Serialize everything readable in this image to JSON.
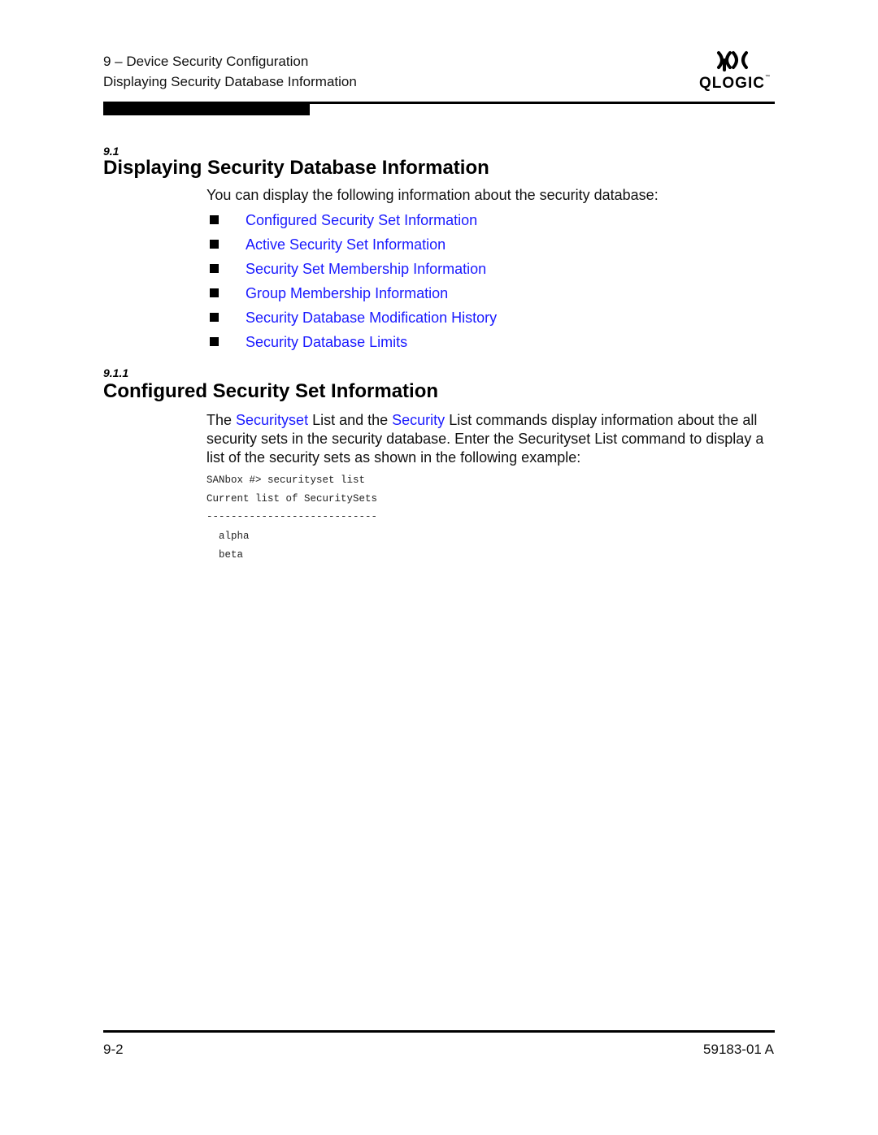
{
  "header": {
    "chapter": "9 – Device Security Configuration",
    "section": "Displaying Security Database Information",
    "logo": {
      "icon": "qlogic-logo-icon",
      "text": "QLOGIC",
      "trademark": "™"
    }
  },
  "section_9_1": {
    "number": "9.1",
    "title": "Displaying Security Database Information",
    "intro": "You can display the following information about the security database:",
    "links": [
      {
        "label": "Configured Security Set Information"
      },
      {
        "label": "Active Security Set Information"
      },
      {
        "label": "Security Set Membership Information"
      },
      {
        "label": "Group Membership Information"
      },
      {
        "label": "Security Database Modification History"
      },
      {
        "label": "Security Database Limits"
      }
    ],
    "bullet_icon": "square-bullet-icon"
  },
  "section_9_1_1": {
    "number": "9.1.1",
    "title": "Configured Security Set Information",
    "paragraph": {
      "part1": "The ",
      "link1": "Securityset",
      "part2": " List and the ",
      "link2": "Security",
      "part3": " List commands display information about the all security sets in the security database. Enter the Securityset List command to display a list of the security sets as shown in the following example:"
    },
    "code": [
      "SANbox #> securityset list",
      "Current list of SecuritySets",
      "----------------------------",
      "  alpha",
      "  beta"
    ]
  },
  "footer": {
    "page": "9-2",
    "doc_id": "59183-01 A"
  },
  "colors": {
    "link": "#1a1aff",
    "text": "#000000"
  }
}
